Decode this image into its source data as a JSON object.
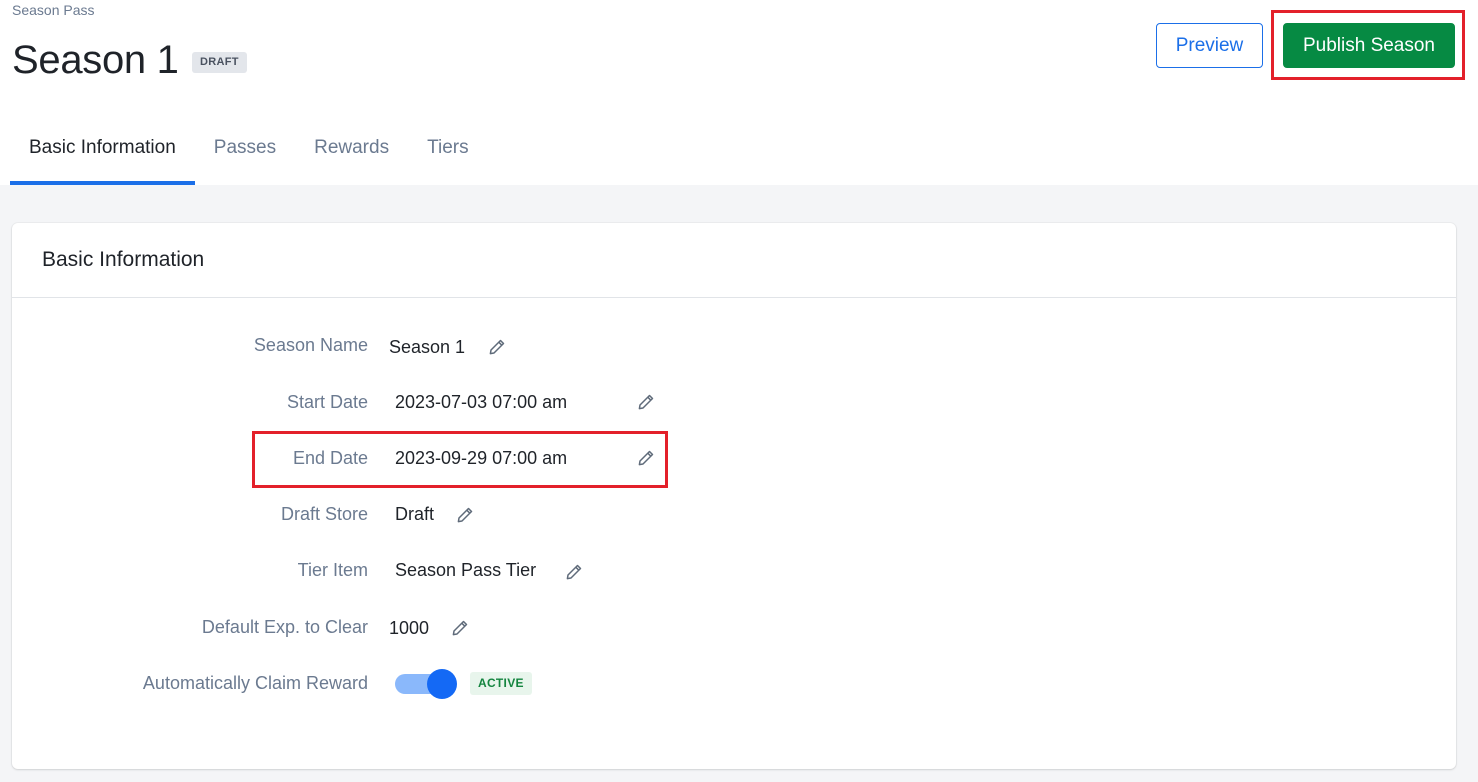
{
  "header": {
    "breadcrumb": "Season Pass",
    "title": "Season 1",
    "status_badge": "DRAFT",
    "preview_label": "Preview",
    "publish_label": "Publish Season"
  },
  "tabs": [
    {
      "label": "Basic Information",
      "active": true
    },
    {
      "label": "Passes",
      "active": false
    },
    {
      "label": "Rewards",
      "active": false
    },
    {
      "label": "Tiers",
      "active": false
    }
  ],
  "card": {
    "title": "Basic Information",
    "fields": [
      {
        "label": "Season Name",
        "value": "Season 1",
        "icon": "pencil-icon"
      },
      {
        "label": "Start Date",
        "value": "2023-07-03 07:00 am",
        "icon": "pencil-icon"
      },
      {
        "label": "End Date",
        "value": "2023-09-29 07:00 am",
        "icon": "pencil-icon"
      },
      {
        "label": "Draft Store",
        "value": "Draft",
        "icon": "pencil-icon"
      },
      {
        "label": "Tier Item",
        "value": "Season Pass Tier",
        "icon": "pencil-icon"
      },
      {
        "label": "Default Exp. to Clear",
        "value": "1000",
        "icon": "pencil-icon"
      }
    ],
    "auto_claim": {
      "label": "Automatically Claim Reward",
      "enabled": true,
      "status_badge": "ACTIVE"
    }
  },
  "colors": {
    "accent": "#1b6fe8",
    "publish": "#068a43",
    "highlight": "#e3202a",
    "active_text": "#14853f"
  }
}
